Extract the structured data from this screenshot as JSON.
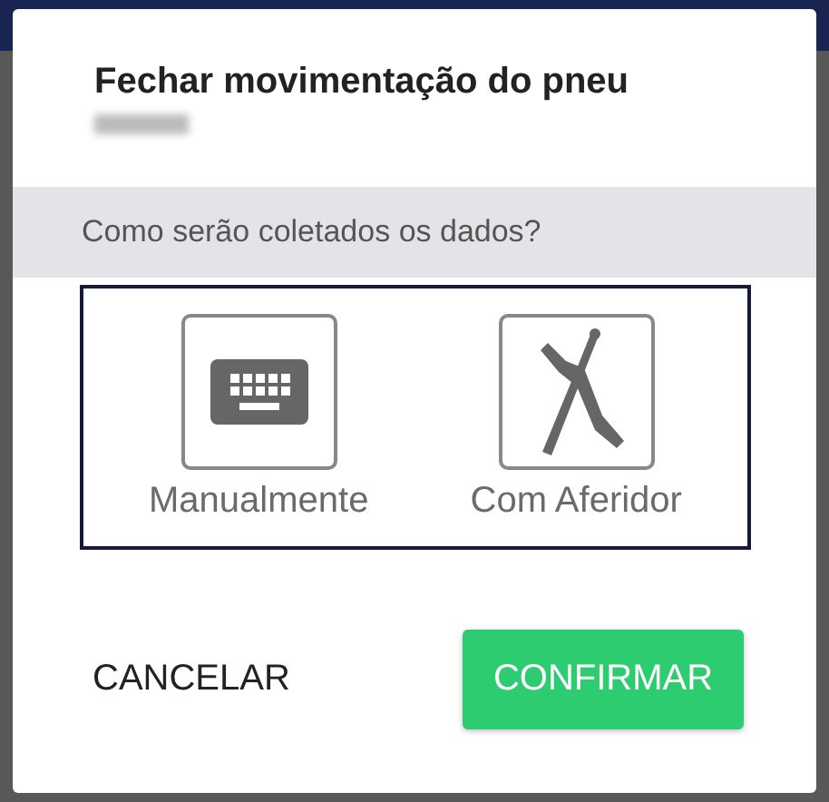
{
  "dialog": {
    "title": "Fechar movimentação do pneu",
    "subtitle_redacted": true,
    "question": "Como serão coletados os dados?",
    "options": [
      {
        "kind": "keyboard",
        "label": "Manualmente"
      },
      {
        "kind": "gauge",
        "label": "Com Aferidor"
      }
    ],
    "buttons": [
      {
        "kind": "text",
        "label": "CANCELAR"
      },
      {
        "kind": "primary",
        "label": "CONFIRMAR"
      }
    ]
  }
}
